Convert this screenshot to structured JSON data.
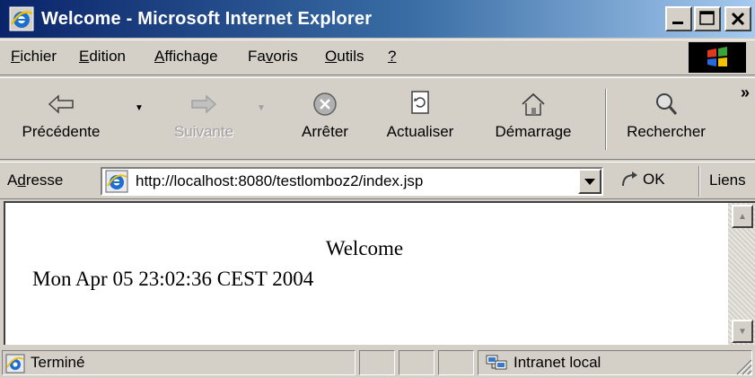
{
  "window": {
    "title": "Welcome - Microsoft Internet Explorer"
  },
  "menu": {
    "items": [
      {
        "label": "Fichier"
      },
      {
        "label": "Edition"
      },
      {
        "label": "Affichage"
      },
      {
        "label": "Favoris"
      },
      {
        "label": "Outils"
      },
      {
        "label": "?"
      }
    ]
  },
  "toolbar": {
    "back": "Précédente",
    "forward": "Suivante",
    "stop": "Arrêter",
    "refresh": "Actualiser",
    "home": "Démarrage",
    "search": "Rechercher",
    "more": "»"
  },
  "address": {
    "label": "Adresse",
    "url": "http://localhost:8080/testlomboz2/index.jsp",
    "go": "OK",
    "links": "Liens"
  },
  "page": {
    "heading": "Welcome",
    "date": "Mon Apr 05 23:02:36 CEST 2004"
  },
  "status": {
    "text": "Terminé",
    "zone": "Intranet local"
  },
  "colors": {
    "title_bar_start": "#0a246a",
    "title_bar_end": "#a6caf0",
    "chrome": "#d4d0c8"
  }
}
